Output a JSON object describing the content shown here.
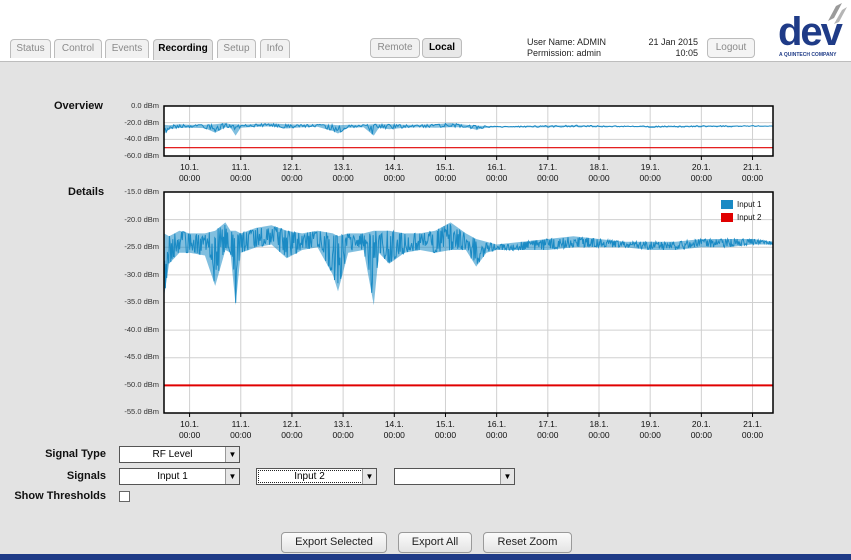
{
  "tabs": [
    {
      "label": "Status",
      "active": false
    },
    {
      "label": "Control",
      "active": false
    },
    {
      "label": "Events",
      "active": false
    },
    {
      "label": "Recording",
      "active": true
    },
    {
      "label": "Setup",
      "active": false
    },
    {
      "label": "Info",
      "active": false
    }
  ],
  "modes": [
    {
      "label": "Remote",
      "active": false
    },
    {
      "label": "Local",
      "active": true
    }
  ],
  "user": {
    "name_line": "User Name: ADMIN",
    "permission_line": "Permission: admin"
  },
  "datetime": {
    "date": "21 Jan 2015",
    "time": "10:05"
  },
  "logout_label": "Logout",
  "logo": {
    "text": "dev",
    "tagline": "A QUINTECH COMPANY"
  },
  "colors": {
    "input1": "#1a8ac4",
    "input2": "#e00000",
    "accent": "#1f3b87"
  },
  "overview": {
    "label": "Overview",
    "y_ticks": [
      "0.0 dBm",
      "-20.0 dBm",
      "-40.0 dBm",
      "-60.0 dBm"
    ]
  },
  "details": {
    "label": "Details",
    "y_ticks": [
      "-15.0 dBm",
      "-20.0 dBm",
      "-25.0 dBm",
      "-30.0 dBm",
      "-35.0 dBm",
      "-40.0 dBm",
      "-45.0 dBm",
      "-50.0 dBm",
      "-55.0 dBm"
    ]
  },
  "x_ticks": [
    "10.1.\n00:00",
    "11.1.\n00:00",
    "12.1.\n00:00",
    "13.1.\n00:00",
    "14.1.\n00:00",
    "15.1.\n00:00",
    "16.1.\n00:00",
    "17.1.\n00:00",
    "18.1.\n00:00",
    "19.1.\n00:00",
    "20.1.\n00:00",
    "21.1.\n00:00"
  ],
  "chart_data": {
    "type": "line",
    "x_unit": "day of January 2015",
    "x_range": [
      9.5,
      21.4
    ],
    "series": [
      {
        "name": "Input 1",
        "color": "#1a8ac4",
        "x": [
          9.5,
          9.6,
          9.8,
          10.0,
          10.3,
          10.5,
          10.7,
          10.8,
          10.9,
          11.0,
          11.3,
          11.6,
          11.9,
          12.2,
          12.5,
          12.8,
          12.9,
          13.1,
          13.4,
          13.6,
          13.7,
          13.9,
          14.2,
          14.5,
          14.8,
          15.1,
          15.4,
          15.6,
          15.8,
          16.0,
          16.5,
          17.0,
          17.5,
          18.0,
          18.5,
          19.0,
          19.5,
          20.0,
          20.5,
          21.0,
          21.4
        ],
        "y": [
          -25,
          -26.5,
          -24.5,
          -24.5,
          -24,
          -28,
          -23.5,
          -24,
          -28,
          -24,
          -23,
          -22.5,
          -24,
          -23.5,
          -23,
          -25,
          -26,
          -24,
          -24,
          -27,
          -24,
          -25,
          -24,
          -24,
          -24,
          -23,
          -23.5,
          -26,
          -25,
          -25,
          -25,
          -25,
          -24.5,
          -24.5,
          -24.5,
          -25,
          -25,
          -24.5,
          -24.5,
          -24,
          -24.5
        ],
        "lower": [
          -34,
          -28,
          -26,
          -26,
          -26.5,
          -32,
          -25.5,
          -26,
          -35.5,
          -26,
          -25,
          -24.5,
          -27,
          -25.5,
          -25,
          -30,
          -33,
          -26,
          -25.5,
          -35.5,
          -26,
          -28,
          -26,
          -25.5,
          -26,
          -25.5,
          -25.5,
          -28.5,
          -26,
          -25.5,
          -25.5,
          -25.5,
          -25,
          -25,
          -25,
          -25.5,
          -25.5,
          -25,
          -25,
          -24.5,
          -24.5
        ],
        "upper": [
          -22.5,
          -23,
          -22,
          -22.5,
          -22.5,
          -22,
          -20.5,
          -22,
          -22,
          -22.5,
          -21.5,
          -21,
          -22,
          -22.5,
          -22,
          -22.5,
          -23,
          -22.5,
          -22.5,
          -22,
          -22,
          -22,
          -22.5,
          -22.5,
          -22,
          -20.5,
          -22.5,
          -23.5,
          -24,
          -24.5,
          -24,
          -23.5,
          -23,
          -23.5,
          -24,
          -24,
          -24,
          -23.5,
          -23.5,
          -23.5,
          -24
        ]
      },
      {
        "name": "Input 2",
        "color": "#e00000",
        "x": [
          9.5,
          21.4
        ],
        "y": [
          -50,
          -50
        ]
      }
    ],
    "overview_ylim": [
      -60,
      0
    ],
    "details_ylim": [
      -55,
      -15
    ],
    "legend": "top-right",
    "grid": true
  },
  "legend": [
    "Input 1",
    "Input 2"
  ],
  "form": {
    "signal_type_label": "Signal Type",
    "signal_type_value": "RF Level",
    "signals_label": "Signals",
    "signals": [
      "Input 1",
      "Input 2",
      ""
    ],
    "thresholds_label": "Show Thresholds"
  },
  "buttons": {
    "export_selected": "Export Selected",
    "export_all": "Export All",
    "reset_zoom": "Reset Zoom"
  }
}
